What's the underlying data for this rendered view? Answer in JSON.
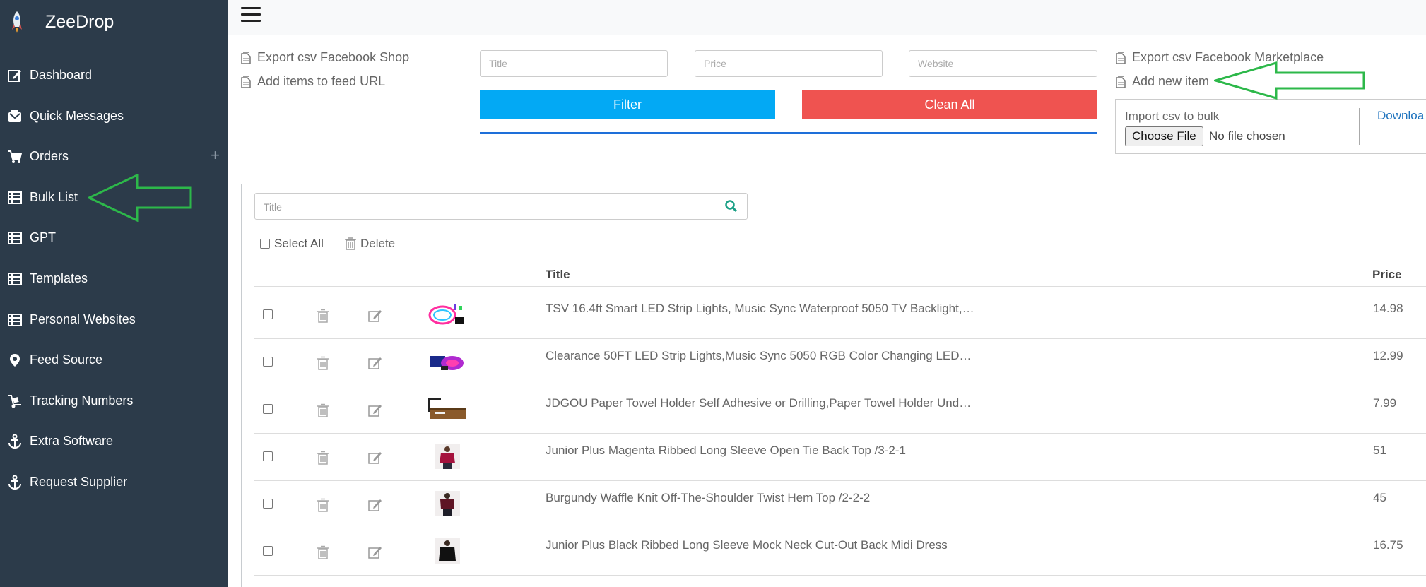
{
  "app": {
    "name": "ZeeDrop"
  },
  "sidebar": {
    "items": [
      {
        "label": "Dashboard",
        "icon": "edit-icon"
      },
      {
        "label": "Quick Messages",
        "icon": "message-icon"
      },
      {
        "label": "Orders",
        "icon": "cart-icon",
        "expand": "+"
      },
      {
        "label": "Bulk List",
        "icon": "table-icon"
      },
      {
        "label": "GPT",
        "icon": "table-icon"
      },
      {
        "label": "Templates",
        "icon": "table-icon"
      },
      {
        "label": "Personal Websites",
        "icon": "table-icon"
      },
      {
        "label": "Feed Source",
        "icon": "map-pin-icon"
      },
      {
        "label": "Tracking Numbers",
        "icon": "dolly-icon"
      },
      {
        "label": "Extra Software",
        "icon": "anchor-icon"
      },
      {
        "label": "Request Supplier",
        "icon": "anchor-icon"
      }
    ]
  },
  "actions": {
    "export_fb_shop": "Export csv Facebook Shop",
    "add_feed_url": "Add items to feed URL",
    "export_fb_marketplace": "Export csv Facebook Marketplace",
    "add_new_item": "Add new item"
  },
  "filters": {
    "title_placeholder": "Title",
    "price_placeholder": "Price",
    "website_placeholder": "Website",
    "filter_label": "Filter",
    "clean_label": "Clean All"
  },
  "import": {
    "label": "Import csv to bulk",
    "choose_label": "Choose File",
    "no_file": "No file chosen",
    "download": "Downloa"
  },
  "list": {
    "search_placeholder": "Title",
    "select_all": "Select All",
    "delete": "Delete",
    "columns": {
      "title": "Title",
      "price": "Price"
    },
    "rows": [
      {
        "title": "TSV 16.4ft Smart LED Strip Lights, Music Sync Waterproof 5050 TV Backlight,…",
        "price": "14.98"
      },
      {
        "title": "Clearance 50FT LED Strip Lights,Music Sync 5050 RGB Color Changing LED…",
        "price": "12.99"
      },
      {
        "title": "JDGOU Paper Towel Holder Self Adhesive or Drilling,Paper Towel Holder Und…",
        "price": "7.99"
      },
      {
        "title": "Junior Plus Magenta Ribbed Long Sleeve Open Tie Back Top /3-2-1",
        "price": "51"
      },
      {
        "title": "Burgundy Waffle Knit Off-The-Shoulder Twist Hem Top /2-2-2",
        "price": "45"
      },
      {
        "title": "Junior Plus Black Ribbed Long Sleeve Mock Neck Cut-Out Back Midi Dress",
        "price": "16.75"
      }
    ]
  },
  "colors": {
    "sidebar_bg": "#2c3b4a",
    "filter_btn": "#03a9f4",
    "clean_btn": "#ef5350",
    "annotation_arrow": "#2db84a"
  }
}
